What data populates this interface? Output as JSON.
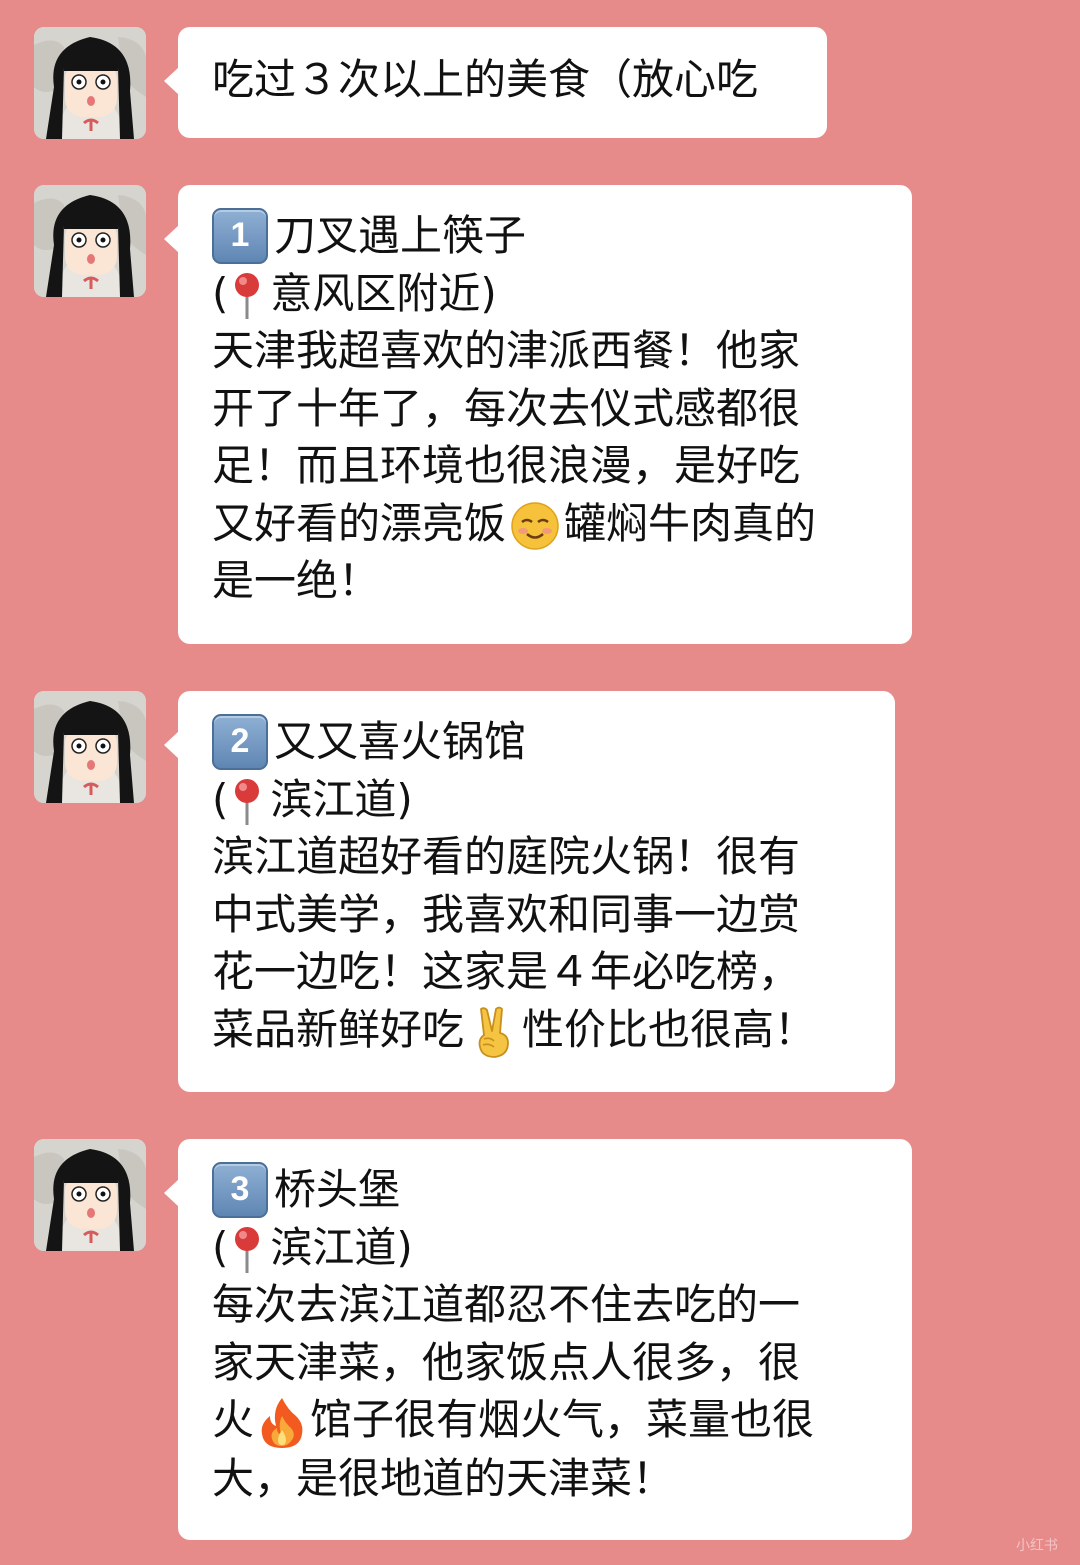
{
  "header_message": {
    "text": "吃过３次以上的美食（放心吃"
  },
  "posts": [
    {
      "number": "1",
      "name": "刀叉遇上筷子",
      "location_open": "(",
      "location": "意风区附近)",
      "body_lines": [
        "天津我超喜欢的津派西餐！他家",
        "开了十年了，每次去仪式感都很",
        "足！而且环境也很浪漫，是好吃"
      ],
      "emoji_line_before": "又好看的漂亮饭",
      "emoji_line_after": "罐焖牛肉真的",
      "last_line": "是一绝！",
      "emoji": "smiling-face-icon"
    },
    {
      "number": "2",
      "name": "又又喜火锅馆",
      "location_open": "(",
      "location": "滨江道)",
      "body_lines": [
        "滨江道超好看的庭院火锅！很有",
        "中式美学，我喜欢和同事一边赏",
        "花一边吃！这家是４年必吃榜，"
      ],
      "emoji_line_before": "菜品新鲜好吃",
      "emoji_line_after": "性价比也很高！",
      "last_line": "",
      "emoji": "victory-hand-icon"
    },
    {
      "number": "3",
      "name": "桥头堡",
      "location_open": "(",
      "location": "滨江道)",
      "body_lines": [
        "每次去滨江道都忍不住去吃的一",
        "家天津菜，他家饭点人很多，很"
      ],
      "emoji_line_before": "火",
      "emoji_line_after": "馆子很有烟火气，菜量也很",
      "last_line": "大，是很地道的天津菜！",
      "emoji": "fire-icon"
    }
  ],
  "watermark": "小红书",
  "colors": {
    "background": "#e68a8a",
    "bubble": "#ffffff",
    "text": "#111111",
    "keycap": "#6b8fbb",
    "pin": "#d93a3a"
  }
}
